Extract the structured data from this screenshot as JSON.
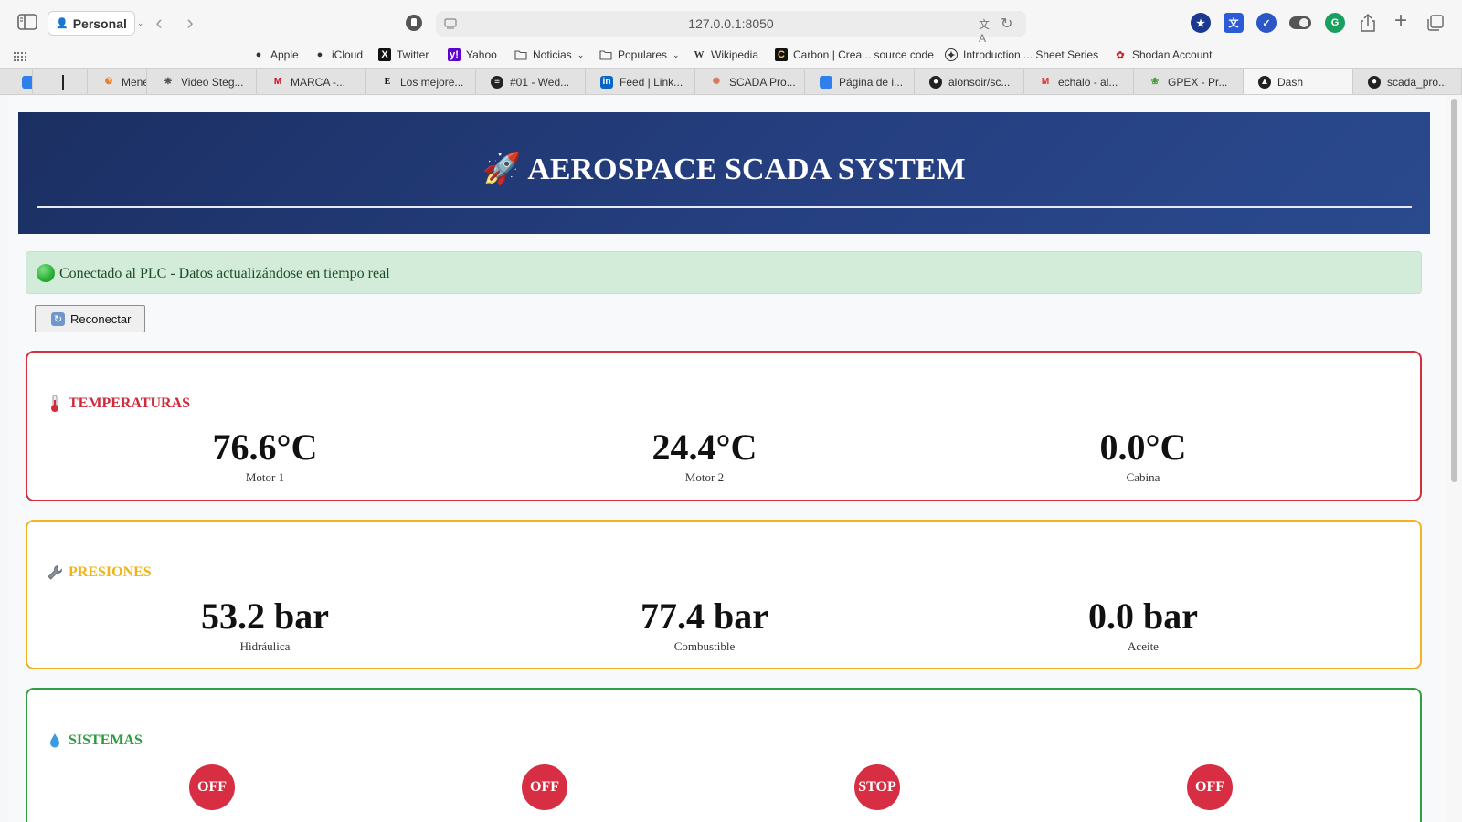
{
  "browser": {
    "profile": "Personal",
    "url": "127.0.0.1:8050",
    "favorites": [
      {
        "label": "Apple",
        "icon": "apple-icon"
      },
      {
        "label": "iCloud",
        "icon": "apple-icon"
      },
      {
        "label": "Twitter",
        "icon": "x-logo-icon"
      },
      {
        "label": "Yahoo",
        "icon": "yahoo-icon"
      },
      {
        "label": "Noticias",
        "icon": "folder-icon",
        "folder": true
      },
      {
        "label": "Populares",
        "icon": "folder-icon",
        "folder": true
      },
      {
        "label": "Wikipedia",
        "icon": "wikipedia-icon"
      },
      {
        "label": "Carbon | Crea... source code",
        "icon": "carbon-icon"
      },
      {
        "label": "Introduction ... Sheet Series",
        "icon": "owasp-icon"
      },
      {
        "label": "Shodan Account",
        "icon": "shodan-icon"
      }
    ],
    "tabs": [
      {
        "label": "",
        "icon": "blue-square-icon"
      },
      {
        "label": "",
        "icon": "cursor-icon"
      },
      {
        "label": "Menéame",
        "icon": "meneame-icon"
      },
      {
        "label": "Video Steg...",
        "icon": "bug-icon"
      },
      {
        "label": "MARCA -...",
        "icon": "marca-icon"
      },
      {
        "label": "Los mejore...",
        "icon": "e-icon"
      },
      {
        "label": "#01 - Wed...",
        "icon": "podcast-icon"
      },
      {
        "label": "Feed | Link...",
        "icon": "linkedin-icon"
      },
      {
        "label": "SCADA Pro...",
        "icon": "claude-icon"
      },
      {
        "label": "Página de i...",
        "icon": "blue-square-icon"
      },
      {
        "label": "alonsoir/sc...",
        "icon": "github-icon"
      },
      {
        "label": "echalo - al...",
        "icon": "gmail-icon"
      },
      {
        "label": "GPEX - Pr...",
        "icon": "gpex-icon"
      },
      {
        "label": "Dash",
        "icon": "dash-icon",
        "active": true
      },
      {
        "label": "scada_pro...",
        "icon": "github-icon"
      }
    ]
  },
  "page": {
    "title": "AEROSPACE SCADA SYSTEM",
    "title_icon": "rocket-icon",
    "status_message": "Conectado al PLC - Datos actualizándose en tiempo real",
    "reconnect_label": "Reconectar",
    "temperaturas": {
      "title": "TEMPERATURAS",
      "icon": "thermometer-icon",
      "accent": "#d32f3d",
      "metrics": [
        {
          "value": "76.6°C",
          "label": "Motor 1"
        },
        {
          "value": "24.4°C",
          "label": "Motor 2"
        },
        {
          "value": "0.0°C",
          "label": "Cabina"
        }
      ]
    },
    "presiones": {
      "title": "PRESIONES",
      "icon": "wrench-icon",
      "accent": "#f3b21f",
      "metrics": [
        {
          "value": "53.2 bar",
          "label": "Hidráulica"
        },
        {
          "value": "77.4 bar",
          "label": "Combustible"
        },
        {
          "value": "0.0 bar",
          "label": "Aceite"
        }
      ]
    },
    "sistemas": {
      "title": "SISTEMAS",
      "icon": "droplet-icon",
      "accent": "#2f9f44",
      "badges": [
        "OFF",
        "OFF",
        "STOP",
        "OFF"
      ],
      "badge_color": "#d82e44"
    }
  }
}
